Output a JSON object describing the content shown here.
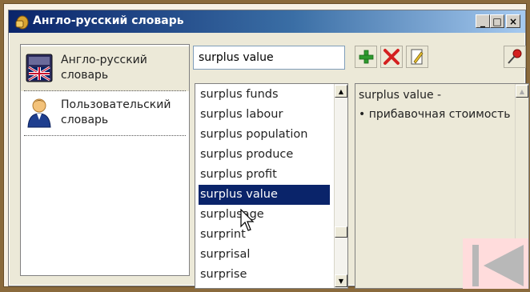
{
  "window": {
    "title": "Англо-русский словарь",
    "minimize": "_",
    "maximize": "□",
    "close": "×"
  },
  "dictionaries": [
    {
      "label": "Англо-русский словарь",
      "icon": "uk-flag-book-icon",
      "selected": true
    },
    {
      "label": "Пользовательский словарь",
      "icon": "user-icon",
      "selected": false
    }
  ],
  "search": {
    "value": "surplus value"
  },
  "toolbar": {
    "add_icon": "plus-icon",
    "delete_icon": "delete-x-icon",
    "edit_icon": "edit-icon",
    "pin_icon": "pin-icon"
  },
  "word_list": {
    "items": [
      "surplus funds",
      "surplus labour",
      "surplus population",
      "surplus produce",
      "surplus profit",
      "surplus value",
      "surplusage",
      "surprint",
      "surprisal",
      "surprise"
    ],
    "selected": "surplus value"
  },
  "translation": {
    "headword": "surplus value -",
    "meaning": "• прибавочная стоимость"
  },
  "colors": {
    "selection": "#0a246a",
    "titlebar_start": "#0a246a",
    "titlebar_end": "#a6caf0",
    "nav_overlay": "#ffdcdc"
  },
  "nav": {
    "back_icon": "back-to-start-icon"
  }
}
